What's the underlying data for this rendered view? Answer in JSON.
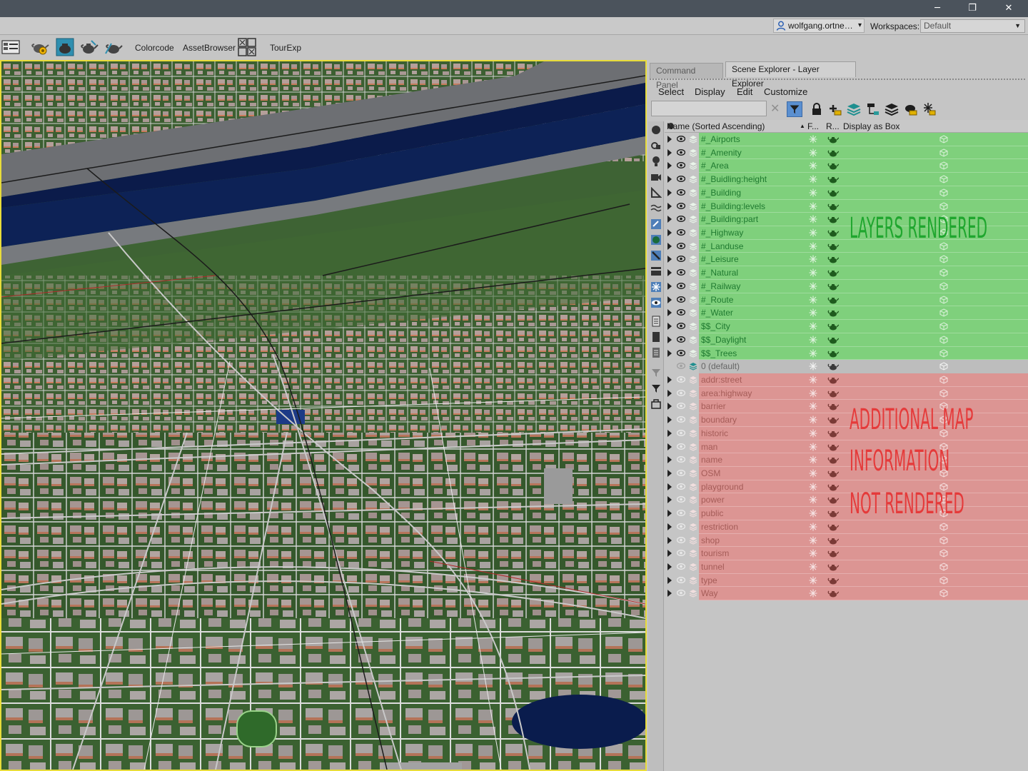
{
  "titlebar": {
    "minimize_glyph": "─",
    "restore_glyph": "❐",
    "close_glyph": "✕"
  },
  "account": {
    "user": "wolfgang.ortne…",
    "user_caret": "▾",
    "workspaces_label": "Workspaces:",
    "workspace_value": "Default",
    "workspace_arrow": "▼"
  },
  "toolbar": {
    "icons": [
      "scene-manager-icon",
      "render-setup-icon",
      "render-frame-icon",
      "render-icon",
      "render-activeshade-icon",
      "script-grid-icon"
    ],
    "colorcode_label": "Colorcode",
    "assetbrowser_label": "AssetBrowser",
    "tourexp_label": "TourExp"
  },
  "panel": {
    "tabs": [
      "Command Panel",
      "Scene Explorer - Layer Explorer"
    ],
    "menu": [
      "Select",
      "Display",
      "Edit",
      "Customize"
    ],
    "search_clear_glyph": "✕",
    "tool_icons": [
      "filter-icon",
      "lock-icon",
      "create-layer-icon",
      "add-to-layer-icon",
      "hierarchy-icon",
      "layers-icon",
      "teapot-layer-icon",
      "freeze-layer-icon"
    ],
    "columns": {
      "name": "Name (Sorted Ascending)",
      "sort_glyph": "▲",
      "frozen": "F...",
      "renderable": "R...",
      "display_as_box": "Display as Box"
    },
    "layers_rendered": [
      "#_Airports",
      "#_Amenity",
      "#_Area",
      "#_Buidling:height",
      "#_Building",
      "#_Building:levels",
      "#_Building:part",
      "#_Highway",
      "#_Landuse",
      "#_Leisure",
      "#_Natural",
      "#_Railway",
      "#_Route",
      "#_Water",
      "$$_City",
      "$$_Daylight",
      "$$_Trees"
    ],
    "default_layer": "0 (default)",
    "layers_not_rendered": [
      "addr:street",
      "area:highway",
      "barrier",
      "boundary",
      "historic",
      "man",
      "name",
      "OSM",
      "playground",
      "power",
      "public",
      "restriction",
      "shop",
      "tourism",
      "tunnel",
      "type",
      "Way"
    ]
  },
  "annotations": {
    "rendered": "LAYERS RENDERED",
    "not_rendered_line1": "ADDITIONAL MAP",
    "not_rendered_line2": "INFORMATION",
    "not_rendered_line3": "NOT RENDERED"
  },
  "colors": {
    "rendered_highlight": "#7fd07c",
    "not_rendered_highlight": "#dc9593",
    "rendered_annotation": "#1fa62e",
    "not_rendered_annotation": "#e53a3a",
    "viewport_border": "#e8dc3a"
  }
}
